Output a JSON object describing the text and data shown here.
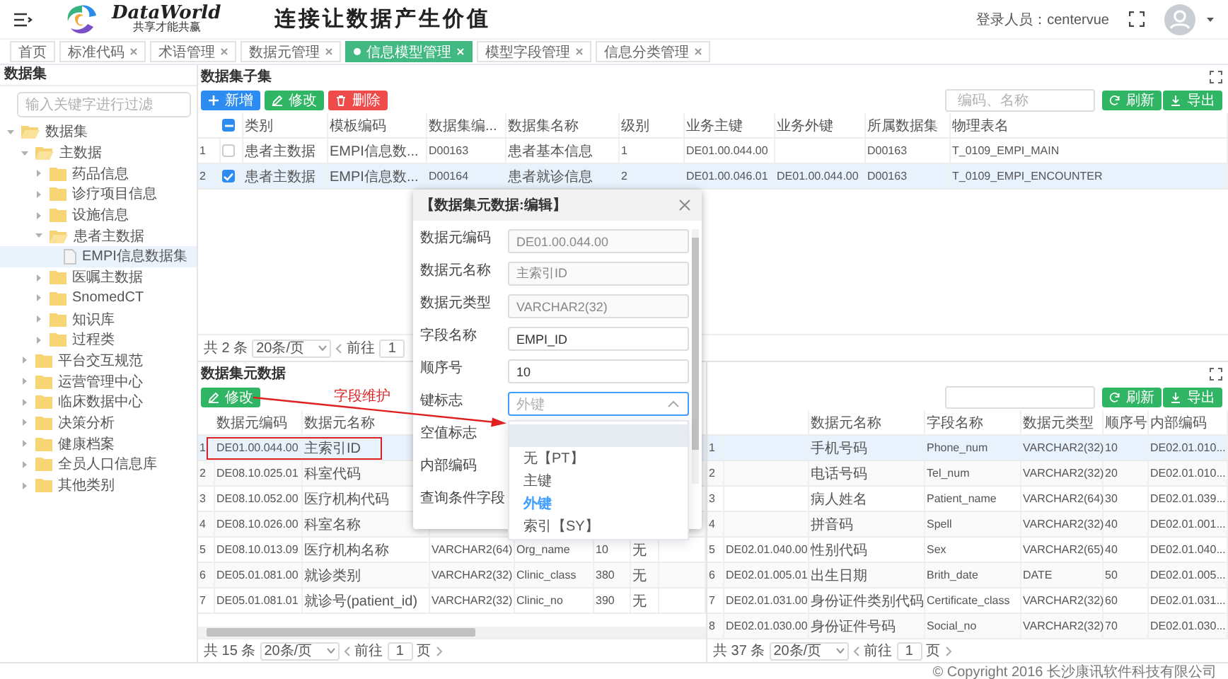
{
  "header": {
    "logo_text": "DataWorld",
    "logo_tagline": "共享才能共赢",
    "slogan": "连接让数据产生价值",
    "user_label": "登录人员：centervue"
  },
  "tabs": [
    {
      "label": "首页",
      "selected": false,
      "closable": false
    },
    {
      "label": "标准代码",
      "selected": false,
      "closable": true
    },
    {
      "label": "术语管理",
      "selected": false,
      "closable": true
    },
    {
      "label": "数据元管理",
      "selected": false,
      "closable": true
    },
    {
      "label": "信息模型管理",
      "selected": true,
      "closable": true
    },
    {
      "label": "模型字段管理",
      "selected": false,
      "closable": true
    },
    {
      "label": "信息分类管理",
      "selected": false,
      "closable": true
    }
  ],
  "sidebar": {
    "title": "数据集",
    "filter_placeholder": "输入关键字进行过滤",
    "tree": [
      {
        "label": "数据集",
        "kind": "folder",
        "expanded": true,
        "selected": false,
        "children": [
          {
            "label": "主数据",
            "kind": "folder",
            "expanded": true,
            "selected": false,
            "children": [
              {
                "label": "药品信息",
                "kind": "folder",
                "expanded": false,
                "selected": false
              },
              {
                "label": "诊疗项目信息",
                "kind": "folder",
                "expanded": false,
                "selected": false
              },
              {
                "label": "设施信息",
                "kind": "folder",
                "expanded": false,
                "selected": false
              },
              {
                "label": "患者主数据",
                "kind": "folder",
                "expanded": true,
                "selected": false,
                "children": [
                  {
                    "label": "EMPI信息数据集",
                    "kind": "file",
                    "selected": true
                  }
                ]
              },
              {
                "label": "医嘱主数据",
                "kind": "folder",
                "expanded": false,
                "selected": false
              },
              {
                "label": "SnomedCT",
                "kind": "folder",
                "expanded": false,
                "selected": false
              },
              {
                "label": "知识库",
                "kind": "folder",
                "expanded": false,
                "selected": false
              },
              {
                "label": "过程类",
                "kind": "folder",
                "expanded": false,
                "selected": false
              }
            ]
          },
          {
            "label": "平台交互规范",
            "kind": "folder",
            "expanded": false,
            "selected": false
          },
          {
            "label": "运营管理中心",
            "kind": "folder",
            "expanded": false,
            "selected": false
          },
          {
            "label": "临床数据中心",
            "kind": "folder",
            "expanded": false,
            "selected": false
          },
          {
            "label": "决策分析",
            "kind": "folder",
            "expanded": false,
            "selected": false
          },
          {
            "label": "健康档案",
            "kind": "folder",
            "expanded": false,
            "selected": false
          },
          {
            "label": "全员人口信息库",
            "kind": "folder",
            "expanded": false,
            "selected": false
          },
          {
            "label": "其他类别",
            "kind": "folder",
            "expanded": false,
            "selected": false
          }
        ]
      }
    ]
  },
  "subset_panel": {
    "title": "数据集子集",
    "buttons": [
      {
        "kind": "add",
        "label": "新增"
      },
      {
        "kind": "edit",
        "label": "修改"
      },
      {
        "kind": "delete",
        "label": "删除"
      }
    ],
    "search_placeholder": "编码、名称",
    "actions": [
      {
        "kind": "refresh",
        "label": "刷新"
      },
      {
        "kind": "export",
        "label": "导出"
      }
    ],
    "header_indeterminate": true,
    "columns": [
      "类别",
      "模板编码",
      "数据集编...",
      "数据集名称",
      "级别",
      "业务主键",
      "业务外键",
      "所属数据集",
      "物理表名"
    ],
    "rows": [
      {
        "index": "1",
        "checked": false,
        "selected": false,
        "cells": [
          "患者主数据",
          "EMPI信息数...",
          "D00163",
          "患者基本信息",
          "1",
          "DE01.00.044.00",
          null,
          "D00163",
          "T_0109_EMPI_MAIN"
        ]
      },
      {
        "index": "2",
        "checked": true,
        "selected": true,
        "cells": [
          "患者主数据",
          "EMPI信息数...",
          "D00164",
          "患者就诊信息",
          "2",
          "DE01.00.046.01",
          "DE01.00.044.00",
          "D00163",
          "T_0109_EMPI_ENCOUNTER"
        ]
      }
    ],
    "pagination": {
      "total": "共 2 条",
      "page_size": "20条/页",
      "goto": "前往",
      "page": "1"
    }
  },
  "elements_panel": {
    "title": "数据集元数据",
    "buttons": [
      {
        "kind": "edit",
        "label": "修改"
      }
    ],
    "columns": [
      "数据元编码",
      "数据元名称",
      null,
      null,
      null,
      null
    ],
    "rows": [
      {
        "index": "1",
        "selected": true,
        "cells": [
          "DE01.00.044.00",
          "主索引ID",
          null,
          null,
          null,
          null
        ]
      },
      {
        "index": "2",
        "selected": false,
        "cells": [
          "DE08.10.025.01",
          "科室代码",
          null,
          null,
          null,
          null
        ]
      },
      {
        "index": "3",
        "selected": false,
        "cells": [
          "DE08.10.052.00",
          "医疗机构代码",
          null,
          null,
          null,
          null
        ]
      },
      {
        "index": "4",
        "selected": false,
        "cells": [
          "DE08.10.026.00",
          "科室名称",
          null,
          null,
          null,
          null
        ]
      },
      {
        "index": "5",
        "selected": false,
        "cells": [
          "DE08.10.013.09",
          "医疗机构名称",
          "VARCHAR2(64)",
          "Org_name",
          "10",
          "无"
        ]
      },
      {
        "index": "6",
        "selected": false,
        "cells": [
          "DE05.01.081.00",
          "就诊类别",
          "VARCHAR2(32)",
          "Clinic_class",
          "380",
          "无"
        ]
      },
      {
        "index": "7",
        "selected": false,
        "cells": [
          "DE05.01.081.01",
          "就诊号(patient_id)",
          "VARCHAR2(32)",
          "Clinic_no",
          "390",
          "无"
        ]
      }
    ],
    "pagination": {
      "total": "共 15 条",
      "page_size": "20条/页",
      "goto": "前往",
      "page": "1",
      "unit": "页"
    }
  },
  "fields_panel": {
    "actions": [
      {
        "kind": "refresh",
        "label": "刷新"
      },
      {
        "kind": "export",
        "label": "导出"
      }
    ],
    "columns": [
      null,
      "数据元名称",
      "字段名称",
      "数据元类型",
      "顺序号",
      "内部编码"
    ],
    "rows": [
      {
        "index": "1",
        "selected": true,
        "cells": [
          null,
          "手机号码",
          "Phone_num",
          "VARCHAR2(32)",
          "10",
          "DE02.01.010..."
        ]
      },
      {
        "index": "2",
        "selected": false,
        "cells": [
          null,
          "电话号码",
          "Tel_num",
          "VARCHAR2(32)",
          "20",
          "DE02.01.010..."
        ]
      },
      {
        "index": "3",
        "selected": false,
        "cells": [
          null,
          "病人姓名",
          "Patient_name",
          "VARCHAR2(64)",
          "30",
          "DE02.01.039..."
        ]
      },
      {
        "index": "4",
        "selected": false,
        "cells": [
          null,
          "拼音码",
          "Spell",
          "VARCHAR2(32)",
          "40",
          "DE02.01.001..."
        ]
      },
      {
        "index": "5",
        "selected": false,
        "cells": [
          "DE02.01.040.00",
          "性别代码",
          "Sex",
          "VARCHAR2(65)",
          "40",
          "DE02.01.040..."
        ]
      },
      {
        "index": "6",
        "selected": false,
        "cells": [
          "DE02.01.005.01",
          "出生日期",
          "Brith_date",
          "DATE",
          "50",
          "DE02.01.005..."
        ]
      },
      {
        "index": "7",
        "selected": false,
        "cells": [
          "DE02.01.031.00",
          "身份证件类别代码",
          "Certificate_class",
          "VARCHAR2(32)",
          "60",
          "DE02.01.031..."
        ]
      },
      {
        "index": "8",
        "selected": false,
        "cells": [
          "DE02.01.030.00",
          "身份证件号码",
          "Social_no",
          "VARCHAR2(32)",
          "70",
          "DE02.01.030..."
        ]
      }
    ],
    "pagination": {
      "total": "共 37 条",
      "page_size": "20条/页",
      "goto": "前往",
      "page": "1",
      "unit": "页"
    }
  },
  "edit_dialog": {
    "title": "【数据集元数据:编辑】",
    "fields": [
      {
        "label": "数据元编码",
        "kind": "text",
        "value": "DE01.00.044.00",
        "disabled": true
      },
      {
        "label": "数据元名称",
        "kind": "text",
        "value": "主索引ID",
        "disabled": true
      },
      {
        "label": "数据元类型",
        "kind": "text",
        "value": "VARCHAR2(32)",
        "disabled": true
      },
      {
        "label": "字段名称",
        "kind": "text",
        "value": "EMPI_ID",
        "disabled": false
      },
      {
        "label": "顺序号",
        "kind": "text",
        "value": "10",
        "disabled": false
      },
      {
        "label": "键标志",
        "kind": "select",
        "placeholder": "外键",
        "open": true
      },
      {
        "label": "空值标志",
        "kind": "covered"
      },
      {
        "label": "内部编码",
        "kind": "covered"
      },
      {
        "label": "查询条件字段",
        "kind": "covered"
      }
    ],
    "options": [
      {
        "kind": "blank",
        "hovered": true
      },
      {
        "kind": "option",
        "label": "无【PT】",
        "selected": false
      },
      {
        "kind": "option",
        "label": "主键",
        "selected": false
      },
      {
        "kind": "option",
        "label": "外键",
        "selected": true
      },
      {
        "kind": "option",
        "label": "索引【SY】",
        "selected": false
      }
    ]
  },
  "annotation": {
    "label": "字段维护"
  },
  "footer": "© Copyright 2016 长沙康讯软件科技有限公司"
}
